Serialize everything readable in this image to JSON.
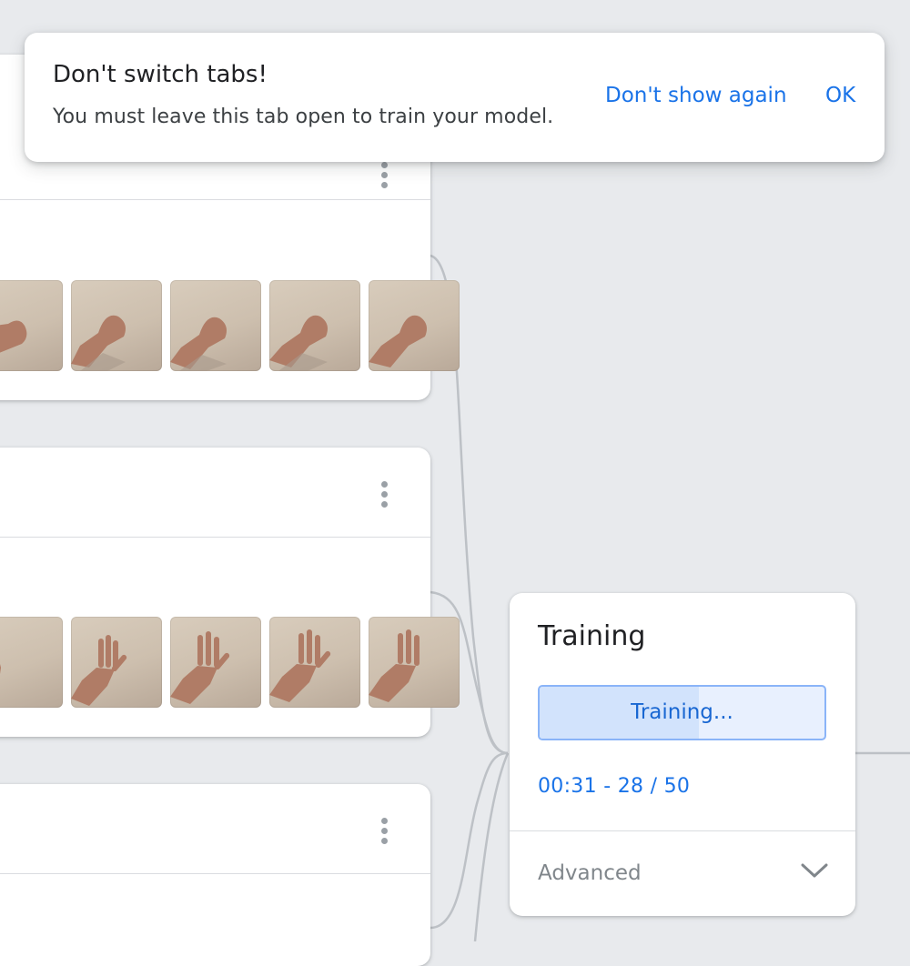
{
  "toast": {
    "title": "Don't switch tabs!",
    "message": "You must leave this tab open to train your model.",
    "dont_show_again_label": "Don't show again",
    "ok_label": "OK"
  },
  "class_cards": [
    {
      "sample_icons": [
        "fist-hand-image",
        "fist-hand-image",
        "fist-hand-image",
        "fist-hand-image",
        "fist-hand-image"
      ],
      "menu_icon": "more-vert-icon"
    },
    {
      "sample_icons": [
        "open-hand-image",
        "open-hand-image",
        "open-hand-image",
        "open-hand-image",
        "open-hand-image"
      ],
      "menu_icon": "more-vert-icon"
    },
    {
      "sample_icons": [],
      "menu_icon": "more-vert-icon"
    }
  ],
  "training": {
    "title": "Training",
    "button_label": "Training...",
    "progress_fraction": 0.56,
    "progress_text": "00:31 - 28 / 50",
    "advanced_label": "Advanced",
    "advanced_icon": "chevron-down-icon"
  },
  "colors": {
    "background": "#e8eaed",
    "accent_blue": "#1a73e8",
    "button_fill": "#d2e3fc",
    "button_border": "#8ab4f8",
    "muted_text": "#80868b"
  }
}
